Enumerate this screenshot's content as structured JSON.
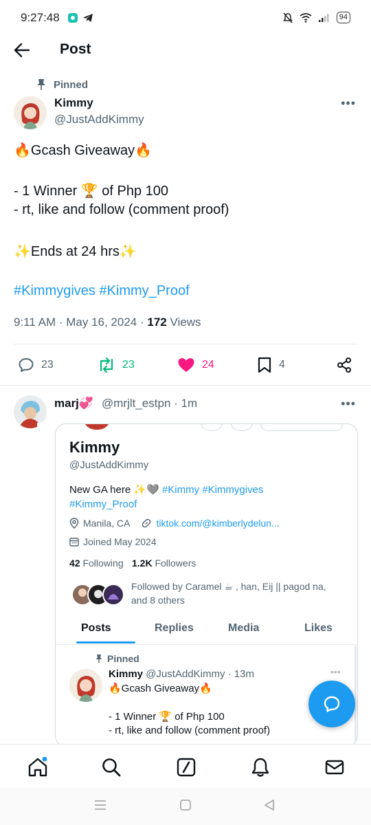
{
  "status_bar": {
    "time": "9:27:48",
    "battery": "94"
  },
  "header": {
    "title": "Post"
  },
  "tweet": {
    "pinned_label": "Pinned",
    "author_name": "Kimmy",
    "author_handle": "@JustAddKimmy",
    "line1": "🔥Gcash Giveaway🔥",
    "line2": "- 1 Winner 🏆 of Php 100",
    "line3": "- rt, like and follow (comment proof)",
    "line4": "✨Ends at 24 hrs✨",
    "hashtag1": "#Kimmygives",
    "hashtag2": "#Kimmy_Proof",
    "timestamp": "9:11 AM · May 16, 2024 ·",
    "views_count": "172",
    "views_label": "Views",
    "replies": "23",
    "reposts": "23",
    "likes": "24",
    "bookmarks": "4"
  },
  "reply": {
    "name": "marj💞",
    "handle_time": "@mrjlt_estpn · 1m"
  },
  "embedded_profile": {
    "name": "Kimmy",
    "handle": "@JustAddKimmy",
    "bio_text": "New GA here ✨🩶",
    "bio_tag1": "#Kimmy",
    "bio_tag2": "#Kimmygives",
    "bio_tag3": "#Kimmy_Proof",
    "location": "Manila, CA",
    "link": "tiktok.com/@kimberlydelun...",
    "joined": "Joined May 2024",
    "following_count": "42",
    "following_label": "Following",
    "followers_count": "1.2K",
    "followers_label": "Followers",
    "followed_by_line1": "Followed by Caramel ☕ , han, Eij || pagod na,",
    "followed_by_line2": "and 8 others",
    "tabs": [
      "Posts",
      "Replies",
      "Media",
      "Likes"
    ],
    "mini_pinned": "Pinned",
    "mini_name": "Kimmy",
    "mini_handle_time": "@JustAddKimmy · 13m",
    "mini_line1": "🔥Gcash Giveaway🔥",
    "mini_line2": "- 1 Winner 🏆 of Php 100",
    "mini_line3": "- rt, like and follow (comment proof)"
  },
  "colors": {
    "accent": "#1d9bf0",
    "repost": "#00ba7c",
    "like": "#f91880",
    "muted": "#536471"
  }
}
